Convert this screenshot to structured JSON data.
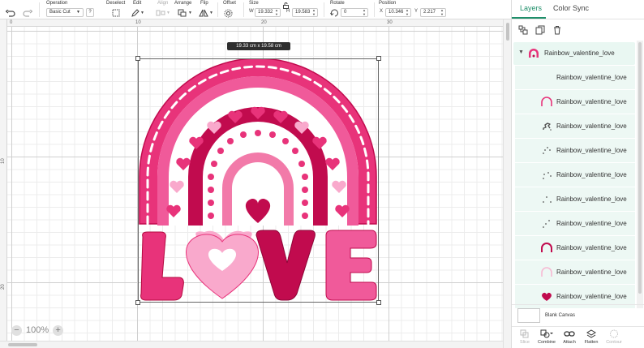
{
  "toolbar": {
    "operation_label": "Operation",
    "operation_value": "Basic Cut",
    "operation_badge": "?",
    "deselect_label": "Deselect",
    "edit_label": "Edit",
    "align_label": "Align",
    "arrange_label": "Arrange",
    "flip_label": "Flip",
    "offset_label": "Offset",
    "size_label": "Size",
    "size_w_letter": "W",
    "size_w_value": "19.332",
    "size_h_letter": "H",
    "size_h_value": "19.583",
    "rotate_label": "Rotate",
    "rotate_value": "0",
    "position_label": "Position",
    "position_x_letter": "X",
    "position_x_value": "10.346",
    "position_y_letter": "Y",
    "position_y_value": "2.217"
  },
  "canvas": {
    "ruler_top": [
      "0",
      "10",
      "20",
      "30"
    ],
    "ruler_left": [
      "10",
      "20"
    ],
    "dimension_tooltip": "19.33  cm x 19.58  cm",
    "zoom_label": "100%",
    "zoom_minus": "−",
    "zoom_plus": "+"
  },
  "panel": {
    "tabs": [
      {
        "label": "Layers",
        "active": true
      },
      {
        "label": "Color Sync",
        "active": false
      }
    ],
    "group_name": "Rainbow_valentine_love",
    "layers": [
      {
        "name": "Rainbow_valentine_love",
        "icon": "blank-icon",
        "color": "#ffffff"
      },
      {
        "name": "Rainbow_valentine_love",
        "icon": "arch-icon",
        "color": "#e8337a"
      },
      {
        "name": "Rainbow_valentine_love",
        "icon": "dots-icon",
        "color": "#555555"
      },
      {
        "name": "Rainbow_valentine_love",
        "icon": "dots-icon",
        "color": "#555555"
      },
      {
        "name": "Rainbow_valentine_love",
        "icon": "dots-icon",
        "color": "#555555"
      },
      {
        "name": "Rainbow_valentine_love",
        "icon": "dots-icon",
        "color": "#555555"
      },
      {
        "name": "Rainbow_valentine_love",
        "icon": "arch-icon",
        "color": "#c10b4e"
      },
      {
        "name": "Rainbow_valentine_love",
        "icon": "arch-icon",
        "color": "#f7b9d3"
      },
      {
        "name": "Rainbow_valentine_love",
        "icon": "arch-icon",
        "color": "#f2619c"
      },
      {
        "name": "Rainbow_valentine_love",
        "icon": "heart-icon",
        "color": "#c10b4e"
      }
    ],
    "blank_canvas_label": "Blank Canvas",
    "bottom_actions": [
      {
        "label": "Slice",
        "enabled": false
      },
      {
        "label": "Combine",
        "enabled": true
      },
      {
        "label": "Attach",
        "enabled": true
      },
      {
        "label": "Flatten",
        "enabled": true
      },
      {
        "label": "Contour",
        "enabled": false
      }
    ]
  },
  "colors": {
    "accent": "#1f8f6a",
    "pink_light": "#f9a9cc",
    "pink_mid": "#f05a9a",
    "pink_hot": "#e8337a",
    "crimson": "#c10b4e",
    "rose": "#f27aa9"
  }
}
